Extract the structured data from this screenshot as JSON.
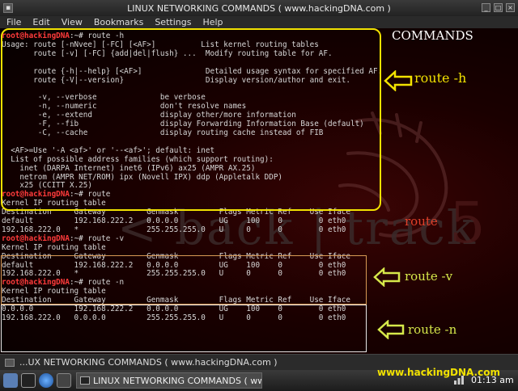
{
  "window": {
    "title": "LINUX NETWORKING COMMANDS ( www.hackingDNA.com )",
    "menu": [
      "File",
      "Edit",
      "View",
      "Bookmarks",
      "Settings",
      "Help"
    ]
  },
  "terminal": {
    "prompt_user": "root@hackingDNA",
    "prompt_path": ":~# ",
    "cmd_h": "route -h",
    "help_lines": [
      "Usage: route [-nNvee] [-FC] [<AF>]          List kernel routing tables",
      "       route [-v] [-FC] {add|del|flush} ...  Modify routing table for AF.",
      "",
      "       route {-h|--help} [<AF>]              Detailed usage syntax for specified AF.",
      "       route {-V|--version}                  Display version/author and exit.",
      "",
      "        -v, --verbose              be verbose",
      "        -n, --numeric              don't resolve names",
      "        -e, --extend               display other/more information",
      "        -F, --fib                  display Forwarding Information Base (default)",
      "        -C, --cache                display routing cache instead of FIB",
      "",
      "  <AF>=Use '-A <af>' or '--<af>'; default: inet",
      "  List of possible address families (which support routing):",
      "    inet (DARPA Internet) inet6 (IPv6) ax25 (AMPR AX.25)",
      "    netrom (AMPR NET/ROM) ipx (Novell IPX) ddp (Appletalk DDP)",
      "    x25 (CCITT X.25)"
    ],
    "cmd_route": "route",
    "cmd_v": "route -v",
    "cmd_n": "route -n",
    "kernel_title": "Kernel IP routing table",
    "table_header": "Destination     Gateway         Genmask         Flags Metric Ref    Use Iface",
    "rows_named": [
      "default         192.168.222.2   0.0.0.0         UG    100    0        0 eth0",
      "192.168.222.0   *               255.255.255.0   U     0      0        0 eth0"
    ],
    "rows_numeric": [
      "0.0.0.0         192.168.222.2   0.0.0.0         UG    100    0        0 eth0",
      "192.168.222.0   0.0.0.0         255.255.255.0   U     0      0        0 eth0"
    ],
    "background_text": "< back | track",
    "background_number": "5"
  },
  "annotations": {
    "commands": "COMMANDS",
    "route_h": "route -h",
    "route": "route",
    "route_v": "route -v",
    "route_n": "route -n",
    "colors": {
      "yellow": "#f2e200",
      "orange": "#d89a55",
      "green_yellow": "#d6e84a",
      "white": "#ffffff",
      "red": "#ff3b3b"
    }
  },
  "taskbar": {
    "tab_label": "...UX NETWORKING COMMANDS ( www.hackingDNA.com )",
    "task_label": "LINUX NETWORKING COMMANDS ( ww",
    "site": "www.hackingDNA.com",
    "clock": "01:13 am"
  }
}
